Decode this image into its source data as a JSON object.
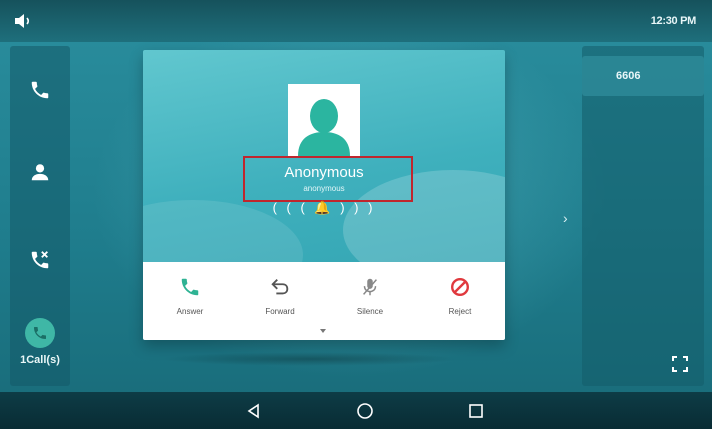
{
  "status_bar": {
    "time": "12:30 PM"
  },
  "sidebar": {
    "items": [
      {
        "name": "phone",
        "icon": "phone-icon"
      },
      {
        "name": "contacts",
        "icon": "contact-icon"
      },
      {
        "name": "history",
        "icon": "call-history-icon"
      }
    ],
    "calls_label": "1Call(s)"
  },
  "right_panel": {
    "line_label": "6606"
  },
  "call": {
    "caller_name": "Anonymous",
    "caller_number": "anonymous",
    "ring_text": "( ( ( 🔔 ) ) )"
  },
  "actions": [
    {
      "label": "Answer",
      "icon": "phone-answer-icon",
      "color": "#2fb394"
    },
    {
      "label": "Forward",
      "icon": "forward-icon",
      "color": "#555555"
    },
    {
      "label": "Silence",
      "icon": "mic-mute-icon",
      "color": "#888888"
    },
    {
      "label": "Reject",
      "icon": "reject-icon",
      "color": "#e0393e"
    }
  ],
  "colors": {
    "accent": "#2fb394",
    "reject": "#e0393e",
    "highlight": "#c0262d",
    "background": "#1f7d8d"
  }
}
